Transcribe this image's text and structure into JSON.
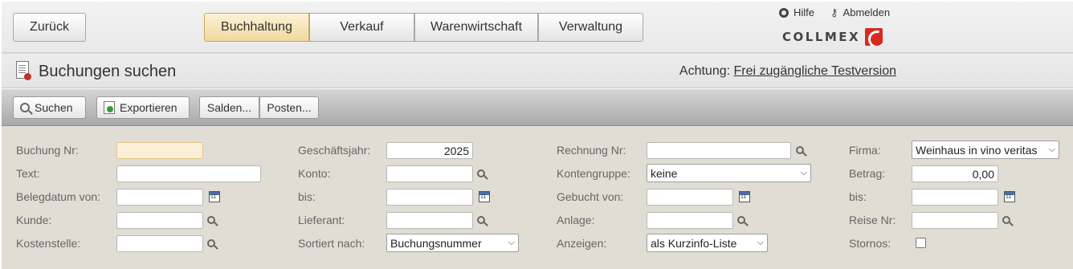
{
  "header": {
    "back_label": "Zurück",
    "tabs": [
      {
        "label": "Buchhaltung",
        "active": true
      },
      {
        "label": "Verkauf",
        "active": false
      },
      {
        "label": "Warenwirtschaft",
        "active": false
      },
      {
        "label": "Verwaltung",
        "active": false
      }
    ],
    "help_label": "Hilfe",
    "logout_label": "Abmelden",
    "logo_text": "COLLMEX"
  },
  "titlebar": {
    "title": "Buchungen suchen",
    "notice_label": "Achtung:",
    "notice_link": "Frei zugängliche Testversion"
  },
  "toolbar": {
    "search_label": "Suchen",
    "export_label": "Exportieren",
    "salden_label": "Salden...",
    "posten_label": "Posten..."
  },
  "form": {
    "buchung_nr": {
      "label": "Buchung Nr:",
      "value": ""
    },
    "text": {
      "label": "Text:",
      "value": ""
    },
    "belegdatum_von": {
      "label": "Belegdatum von:",
      "value": ""
    },
    "kunde": {
      "label": "Kunde:",
      "value": ""
    },
    "kostenstelle": {
      "label": "Kostenstelle:",
      "value": ""
    },
    "geschaeftsjahr": {
      "label": "Geschäftsjahr:",
      "value": "2025"
    },
    "konto": {
      "label": "Konto:",
      "value": ""
    },
    "bis1": {
      "label": "bis:",
      "value": ""
    },
    "lieferant": {
      "label": "Lieferant:",
      "value": ""
    },
    "sortiert_nach": {
      "label": "Sortiert nach:",
      "value": "Buchungsnummer"
    },
    "rechnung_nr": {
      "label": "Rechnung Nr:",
      "value": ""
    },
    "kontengruppe": {
      "label": "Kontengruppe:",
      "value": "keine"
    },
    "gebucht_von": {
      "label": "Gebucht von:",
      "value": ""
    },
    "anlage": {
      "label": "Anlage:",
      "value": ""
    },
    "anzeigen": {
      "label": "Anzeigen:",
      "value": "als Kurzinfo-Liste"
    },
    "firma": {
      "label": "Firma:",
      "value": "Weinhaus in vino veritas"
    },
    "betrag": {
      "label": "Betrag:",
      "value": "0,00"
    },
    "bis2": {
      "label": "bis:",
      "value": ""
    },
    "reise_nr": {
      "label": "Reise Nr:",
      "value": ""
    },
    "stornos": {
      "label": "Stornos:",
      "checked": false
    }
  },
  "colors": {
    "active_tab": "#f0d9a0",
    "form_bg": "#e0ddd5",
    "logo_red": "#d62a20"
  }
}
